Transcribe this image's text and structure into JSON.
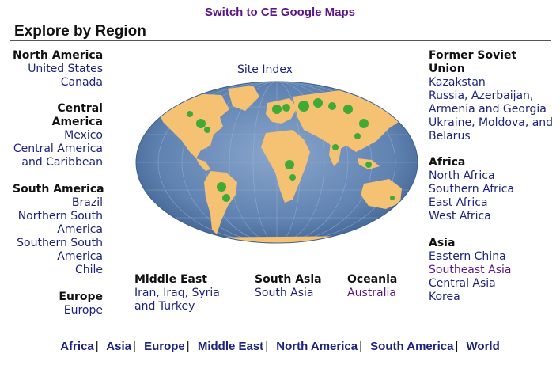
{
  "top_link": "Switch to CE Google Maps",
  "title": "Explore by Region",
  "site_index": "Site Index",
  "left_column": [
    {
      "heading": "North America",
      "links": [
        "United States",
        "Canada"
      ]
    },
    {
      "heading": "Central America",
      "links": [
        "Mexico",
        "Central America and Caribbean"
      ]
    },
    {
      "heading": "South America",
      "links": [
        "Brazil",
        "Northern South America",
        "Southern South America",
        "Chile"
      ]
    },
    {
      "heading": "Europe",
      "links": [
        "Europe"
      ]
    }
  ],
  "center_column": [
    {
      "heading": "Middle East",
      "links": [
        "Iran, Iraq, Syria and Turkey"
      ]
    },
    {
      "heading": "South Asia",
      "links": [
        "South Asia"
      ]
    },
    {
      "heading": "Oceania",
      "links": [
        "Australia"
      ]
    }
  ],
  "right_column": [
    {
      "heading": "Former Soviet Union",
      "links": [
        "Kazakstan",
        "Russia, Azerbaijan, Armenia and Georgia",
        "Ukraine, Moldova, and Belarus"
      ]
    },
    {
      "heading": "Africa",
      "links": [
        "North Africa",
        "Southern Africa",
        "East Africa",
        "West Africa"
      ]
    },
    {
      "heading": "Asia",
      "links": [
        "Eastern China",
        "Southeast Asia",
        "Central Asia",
        "Korea"
      ]
    }
  ],
  "bottom_nav": [
    "Africa",
    "Asia",
    "Europe",
    "Middle East",
    "North America",
    "South America",
    "World"
  ],
  "colors": {
    "link": "#1d237e",
    "visited": "#5b1689",
    "ocean": "#5478a8",
    "land": "#f5c173",
    "vegetation": "#2ca830"
  },
  "icons": {
    "map": "world-map-image"
  }
}
